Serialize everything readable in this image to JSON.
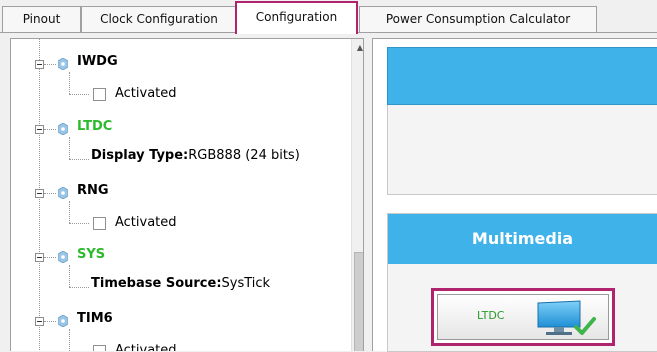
{
  "tabs": [
    {
      "label": "Pinout",
      "active": false
    },
    {
      "label": "Clock Configuration",
      "active": false
    },
    {
      "label": "Configuration",
      "active": true
    },
    {
      "label": "Power Consumption Calculator",
      "active": false
    }
  ],
  "tree": {
    "items": [
      {
        "name": "IWDG",
        "status": "normal",
        "child": {
          "type": "checkbox",
          "label": "Activated",
          "checked": false
        }
      },
      {
        "name": "LTDC",
        "status": "configured",
        "child": {
          "type": "text",
          "key": "Display Type:",
          "value": "RGB888 (24 bits)"
        }
      },
      {
        "name": "RNG",
        "status": "normal",
        "child": {
          "type": "checkbox",
          "label": "Activated",
          "checked": false
        }
      },
      {
        "name": "SYS",
        "status": "configured",
        "child": {
          "type": "text",
          "key": "Timebase Source:",
          "value": "SysTick"
        }
      },
      {
        "name": "TIM6",
        "status": "normal",
        "child": {
          "type": "checkbox",
          "label": "Activated",
          "checked": false
        }
      }
    ]
  },
  "right_panel": {
    "category_title": "Multimedia",
    "ip_button_label": "LTDC"
  },
  "colors": {
    "accent_highlight": "#b0246e",
    "category_blue": "#3eb2e9",
    "configured_green": "#2dbb2d"
  },
  "icons": {
    "ip_node": "ip-gear-icon",
    "ip_button": "monitor-check-icon"
  }
}
